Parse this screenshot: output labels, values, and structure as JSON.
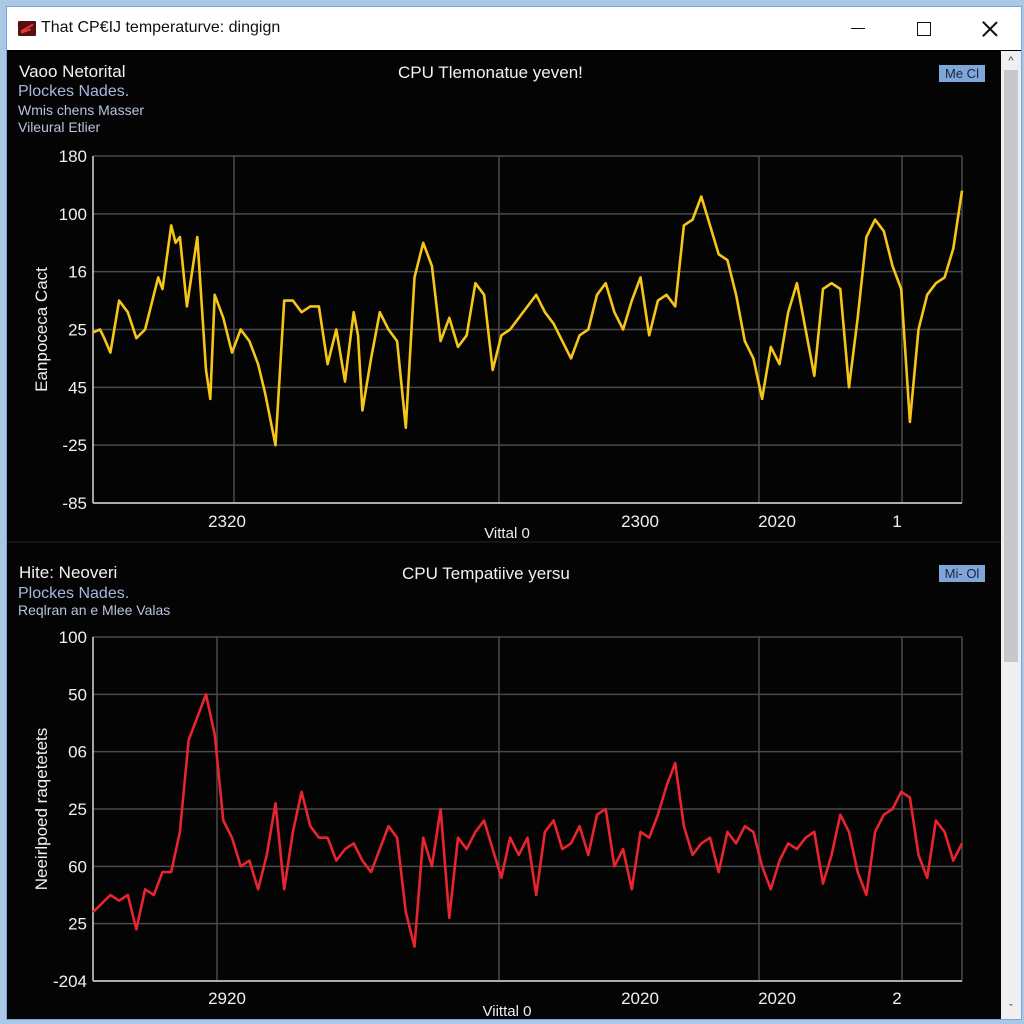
{
  "window": {
    "title": "That CP€IJ temperaturve: dingign",
    "controls": {
      "minimize": "minimize",
      "maximize": "maximize",
      "close": "close"
    }
  },
  "panels": [
    {
      "header": {
        "line1": "Vaoo Netorital",
        "line2": "Plockes Nades.",
        "line3": "Wmis chens Masser",
        "line4": "Vileural Etlier"
      },
      "title": "CPU Tlemonatue yeven!",
      "badge": "Me Cl"
    },
    {
      "header": {
        "line1": "Hite: Neoveri",
        "line2": "Plockes Nades.",
        "line3": "Reqlran an e Mlee Valas"
      },
      "title": "CPU Tempatiive yersu",
      "badge": "Mi- Ol"
    }
  ],
  "colors": {
    "series_top": "#f5c518",
    "series_bottom": "#e8242e",
    "grid": "#4a4a4a",
    "axis": "#d8d8d8",
    "badge": "#7ea6d8"
  },
  "chart_data": [
    {
      "type": "line",
      "title": "CPU Tlemonatue yeven!",
      "xlabel": "Vittal 0",
      "ylabel": "Eanpoceca Cact",
      "y_tick_labels": [
        "180",
        "100",
        "16",
        "25",
        "45",
        "-25",
        "-85"
      ],
      "x_tick_labels": [
        "2320",
        "2300",
        "2020",
        "1"
      ],
      "grid": true,
      "ylim": [
        0,
        6
      ],
      "xlim": [
        0,
        100
      ],
      "series": [
        {
          "name": "top",
          "x": [
            0,
            0.8,
            1.3,
            2,
            3,
            4,
            5,
            6,
            7,
            7.5,
            8,
            9,
            9.5,
            10,
            10.8,
            12,
            13,
            13.5,
            14,
            15,
            16,
            17,
            18,
            19,
            19.8,
            21,
            22,
            23,
            24,
            25,
            26,
            27,
            28,
            29,
            30,
            30.5,
            31,
            32,
            33,
            34,
            35,
            36,
            37,
            38,
            39,
            40,
            41,
            42,
            43,
            44,
            45,
            46,
            47,
            48,
            49,
            50,
            51,
            52,
            53,
            54,
            55,
            56,
            57,
            58,
            59,
            60,
            61,
            62,
            63,
            64,
            65,
            66,
            67,
            68,
            69,
            70,
            71,
            72,
            73,
            74,
            75,
            76,
            77,
            78,
            79,
            80,
            81,
            82,
            83,
            84,
            85,
            86,
            87,
            88,
            89,
            90,
            91,
            92,
            93,
            94,
            95,
            96,
            97,
            98,
            99,
            100
          ],
          "y": [
            2.95,
            3.0,
            2.85,
            2.6,
            3.5,
            3.3,
            2.85,
            3.0,
            3.6,
            3.9,
            3.7,
            4.8,
            4.5,
            4.6,
            3.4,
            4.6,
            2.3,
            1.8,
            3.6,
            3.2,
            2.6,
            3.0,
            2.8,
            2.4,
            1.9,
            1.0,
            3.5,
            3.5,
            3.3,
            3.4,
            3.4,
            2.4,
            3.0,
            2.1,
            3.3,
            2.9,
            1.6,
            2.5,
            3.3,
            3.0,
            2.8,
            1.3,
            3.9,
            4.5,
            4.1,
            2.8,
            3.2,
            2.7,
            2.9,
            3.8,
            3.6,
            2.3,
            2.9,
            3.0,
            3.2,
            3.4,
            3.6,
            3.3,
            3.1,
            2.8,
            2.5,
            2.9,
            3.0,
            3.6,
            3.8,
            3.3,
            3.0,
            3.5,
            3.9,
            2.9,
            3.5,
            3.6,
            3.4,
            4.8,
            4.9,
            5.3,
            4.8,
            4.3,
            4.2,
            3.6,
            2.8,
            2.5,
            1.8,
            2.7,
            2.4,
            3.3,
            3.8,
            3.0,
            2.2,
            3.7,
            3.8,
            3.7,
            2.0,
            3.2,
            4.6,
            4.9,
            4.7,
            4.1,
            3.7,
            1.4,
            3.0,
            3.6,
            3.8,
            3.9,
            4.4,
            5.4,
            4.2,
            3.9,
            4.3
          ]
        }
      ]
    },
    {
      "type": "line",
      "title": "CPU Tempatiive yersu",
      "xlabel": "Viittal 0",
      "ylabel": "Neeirlpoed raqetetets",
      "y_tick_labels": [
        "100",
        "50",
        "06",
        "25",
        "60",
        "25",
        "-204"
      ],
      "x_tick_labels": [
        "2920",
        "2020",
        "2020",
        "2"
      ],
      "grid": true,
      "ylim": [
        0,
        6
      ],
      "xlim": [
        0,
        100
      ],
      "series": [
        {
          "name": "bottom",
          "x": [
            0,
            1,
            2,
            3,
            4,
            5,
            6,
            7,
            8,
            9,
            10,
            11,
            12,
            13,
            14,
            15,
            16,
            17,
            18,
            19,
            20,
            21,
            22,
            23,
            24,
            25,
            26,
            27,
            28,
            29,
            30,
            31,
            32,
            33,
            34,
            35,
            36,
            37,
            38,
            39,
            40,
            41,
            42,
            43,
            44,
            45,
            46,
            47,
            48,
            49,
            50,
            51,
            52,
            53,
            54,
            55,
            56,
            57,
            58,
            59,
            60,
            61,
            62,
            63,
            64,
            65,
            66,
            67,
            68,
            69,
            70,
            71,
            72,
            73,
            74,
            75,
            76,
            77,
            78,
            79,
            80,
            81,
            82,
            83,
            84,
            85,
            86,
            87,
            88,
            89,
            90,
            91,
            92,
            93,
            94,
            95,
            96,
            97,
            98,
            99,
            100
          ],
          "y": [
            1.2,
            1.35,
            1.5,
            1.4,
            1.5,
            0.9,
            1.6,
            1.5,
            1.9,
            1.9,
            2.6,
            4.2,
            4.6,
            5.0,
            4.3,
            2.8,
            2.5,
            2.0,
            2.1,
            1.6,
            2.2,
            3.1,
            1.6,
            2.6,
            3.3,
            2.7,
            2.5,
            2.5,
            2.1,
            2.3,
            2.4,
            2.1,
            1.9,
            2.3,
            2.7,
            2.5,
            1.2,
            0.6,
            2.5,
            2.0,
            3.0,
            1.1,
            2.5,
            2.3,
            2.6,
            2.8,
            2.3,
            1.8,
            2.5,
            2.2,
            2.5,
            1.5,
            2.6,
            2.8,
            2.3,
            2.4,
            2.7,
            2.2,
            2.9,
            3.0,
            2.0,
            2.3,
            1.6,
            2.6,
            2.5,
            2.9,
            3.4,
            3.8,
            2.7,
            2.2,
            2.4,
            2.5,
            1.9,
            2.6,
            2.4,
            2.7,
            2.6,
            2.0,
            1.6,
            2.1,
            2.4,
            2.3,
            2.5,
            2.6,
            1.7,
            2.2,
            2.9,
            2.6,
            1.9,
            1.5,
            2.6,
            2.9,
            3.0,
            3.3,
            3.2,
            2.2,
            1.8,
            2.8,
            2.6,
            2.1,
            2.4
          ]
        }
      ]
    }
  ]
}
